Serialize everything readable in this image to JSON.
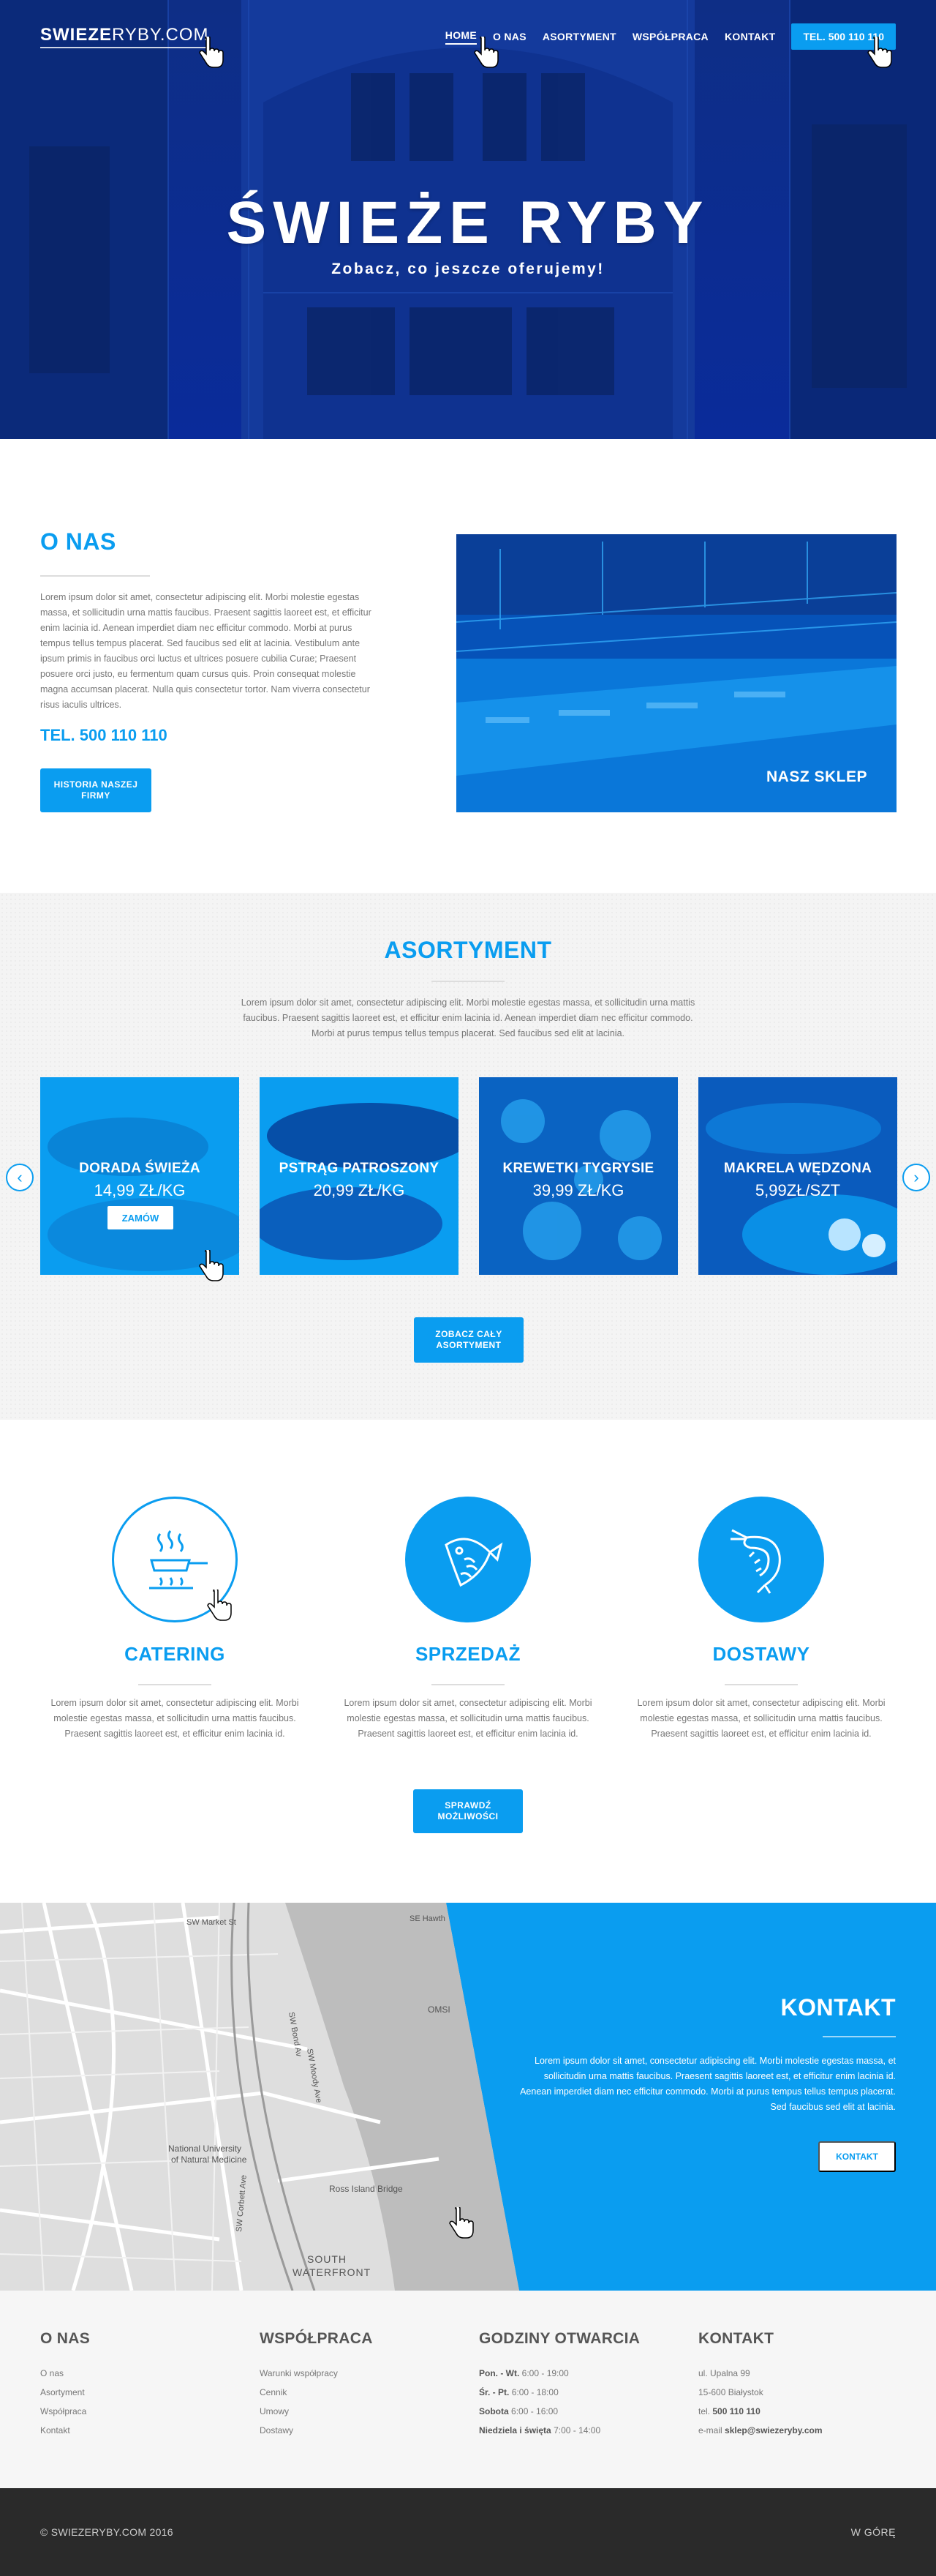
{
  "header": {
    "logo_bold": "SWIEZE",
    "logo_thin": "RYBY.COM",
    "nav": [
      "HOME",
      "O NAS",
      "ASORTYMENT",
      "WSPÓŁPRACA",
      "KONTAKT"
    ],
    "phone_button": "TEL. 500 110 110"
  },
  "hero": {
    "title": "ŚWIEŻE RYBY",
    "subtitle": "Zobacz, co jeszcze oferujemy!"
  },
  "about": {
    "title": "O NAS",
    "text": "Lorem ipsum dolor sit amet, consectetur adipiscing elit. Morbi molestie egestas massa, et sollicitudin urna mattis faucibus. Praesent sagittis laoreet est, et efficitur enim lacinia id. Aenean imperdiet diam nec efficitur commodo. Morbi at purus tempus tellus tempus placerat. Sed faucibus sed elit at lacinia. Vestibulum ante ipsum primis in faucibus orci luctus et ultrices posuere cubilia Curae; Praesent posuere orci justo, eu fermentum quam cursus quis. Proin consequat molestie magna accumsan placerat. Nulla quis consectetur tortor. Nam viverra consectetur risus iaculis ultrices.",
    "phone": "TEL. 500 110 110",
    "history_button": "HISTORIA NASZEJ FIRMY",
    "shop_label": "NASZ SKLEP"
  },
  "assortment": {
    "title": "ASORTYMENT",
    "text": "Lorem ipsum dolor sit amet, consectetur adipiscing elit. Morbi molestie egestas massa, et sollicitudin urna mattis faucibus. Praesent sagittis laoreet est, et efficitur enim lacinia id. Aenean imperdiet diam nec efficitur commodo. Morbi at purus tempus tellus tempus placerat. Sed faucibus sed elit at lacinia.",
    "products": [
      {
        "name": "DORADA ŚWIEŻA",
        "price": "14,99 ZŁ/KG",
        "order": "ZAMÓW"
      },
      {
        "name": "PSTRĄG PATROSZONY",
        "price": "20,99 ZŁ/KG"
      },
      {
        "name": "KREWETKI TYGRYSIE",
        "price": "39,99 ZŁ/KG"
      },
      {
        "name": "MAKRELA WĘDZONA",
        "price": "5,99ZŁ/SZT"
      }
    ],
    "all_button": "ZOBACZ CAŁY ASORTYMENT"
  },
  "services": {
    "items": [
      {
        "title": "CATERING",
        "icon": "pan-icon",
        "text": "Lorem ipsum dolor sit amet, consectetur adipiscing elit. Morbi molestie egestas massa, et sollicitudin urna mattis faucibus. Praesent sagittis laoreet est, et efficitur enim lacinia id."
      },
      {
        "title": "SPRZEDAŻ",
        "icon": "fish-icon",
        "text": "Lorem ipsum dolor sit amet, consectetur adipiscing elit. Morbi molestie egestas massa, et sollicitudin urna mattis faucibus. Praesent sagittis laoreet est, et efficitur enim lacinia id."
      },
      {
        "title": "DOSTAWY",
        "icon": "shrimp-icon",
        "text": "Lorem ipsum dolor sit amet, consectetur adipiscing elit. Morbi molestie egestas massa, et sollicitudin urna mattis faucibus. Praesent sagittis laoreet est, et efficitur enim lacinia id."
      }
    ],
    "button": "SPRAWDŹ MOŻLIWOŚCI"
  },
  "map": {
    "labels": [
      "SW Market St",
      "SE Hawth",
      "OMSI",
      "National University",
      "of Natural Medicine",
      "Ross Island Bridge",
      "SOUTH",
      "WATERFRONT",
      "SW Moody Ave",
      "SW Bond Av",
      "SW Corbett Ave"
    ]
  },
  "contact": {
    "title": "KONTAKT",
    "text": "Lorem ipsum dolor sit amet, consectetur adipiscing elit. Morbi molestie egestas massa, et sollicitudin urna mattis faucibus. Praesent sagittis laoreet est, et efficitur enim lacinia id. Aenean imperdiet diam nec efficitur commodo. Morbi at purus tempus tellus tempus placerat. Sed faucibus sed elit at lacinia.",
    "button": "KONTAKT"
  },
  "footer": {
    "col1": {
      "title": "O NAS",
      "links": [
        "O nas",
        "Asortyment",
        "Współpraca",
        "Kontakt"
      ]
    },
    "col2": {
      "title": "WSPÓŁPRACA",
      "links": [
        "Warunki współpracy",
        "Cennik",
        "Umowy",
        "Dostawy"
      ]
    },
    "col3": {
      "title": "GODZINY OTWARCIA",
      "rows": [
        {
          "days": "Pon. - Wt.",
          "hours": "6:00 - 19:00"
        },
        {
          "days": "Śr. - Pt.",
          "hours": "6:00 - 18:00"
        },
        {
          "days": "Sobota",
          "hours": "6:00 - 16:00"
        },
        {
          "days": "Niedziela i święta",
          "hours": "7:00 - 14:00"
        }
      ]
    },
    "col4": {
      "title": "KONTAKT",
      "address1": "ul. Upalna 99",
      "address2": "15-600 Białystok",
      "tel_label": "tel.",
      "tel": "500 110 110",
      "email_label": "e-mail",
      "email": "sklep@swiezeryby.com"
    },
    "copyright": "© SWIEZERYBY.COM 2016",
    "back_to_top": "W GÓRĘ"
  },
  "colors": {
    "accent": "#0a9df0",
    "hero_blue": "#0b2d8a",
    "footer_dark": "#2a2a2a"
  }
}
